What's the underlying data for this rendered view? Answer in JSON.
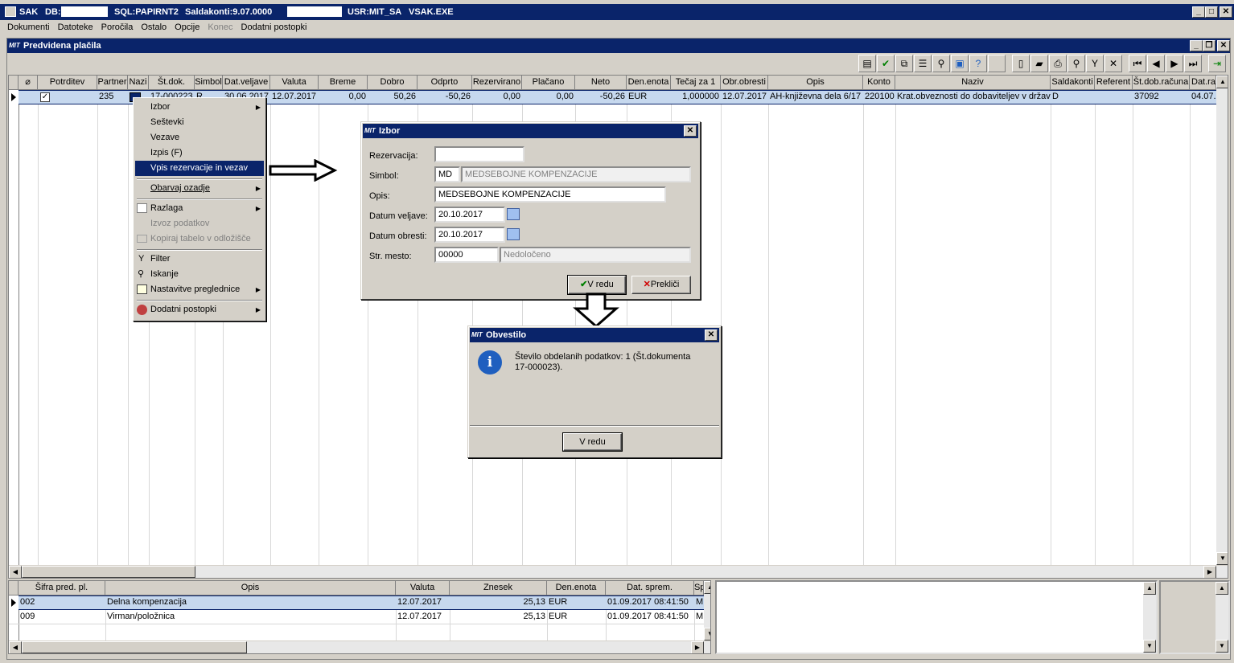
{
  "app_title": {
    "app": "SAK",
    "db": "DB:",
    "sql": "SQL:PAPIRNT2",
    "saldakonti": "Saldakonti:9.07.0000",
    "usr": "USR:MIT_SA",
    "exe": "VSAK.EXE"
  },
  "menu": [
    "Dokumenti",
    "Datoteke",
    "Poročila",
    "Ostalo",
    "Opcije",
    "Konec",
    "Dodatni postopki"
  ],
  "menu_disabled": [
    false,
    false,
    false,
    false,
    false,
    true,
    false
  ],
  "child_window": {
    "title": "Predvidena plačila",
    "logo": "MIT"
  },
  "main_grid": {
    "headers": [
      "Potrditev",
      "Partner",
      "Nazi",
      "Št.dok.",
      "Simbol",
      "Dat.veljave",
      "Valuta",
      "Breme",
      "Dobro",
      "Odprto",
      "Rezervirano",
      "Plačano",
      "Neto",
      "Den.enota",
      "Tečaj za 1",
      "Obr.obresti",
      "Opis",
      "Konto",
      "Naziv",
      "Saldakonti",
      "Referent",
      "Št.dob.računa",
      "Dat.rač"
    ],
    "row": {
      "partner": "235",
      "stdok": "17-000223",
      "simbol": "R",
      "datveljave": "30.06.2017",
      "valuta": "12.07.2017",
      "breme": "0,00",
      "dobro": "50,26",
      "odprto": "-50,26",
      "rezervirano": "0,00",
      "placano": "0,00",
      "neto": "-50,26",
      "denenota": "EUR",
      "tecaj": "1,000000",
      "obrobresti": "12.07.2017",
      "opis": "AH-književna dela 6/17",
      "konto": "220100",
      "naziv": "Krat.obveznosti do dobaviteljev v državi",
      "saldakonti": "D",
      "referent": "",
      "stdobracuna": "37092",
      "datrac": "04.07."
    }
  },
  "context_menu": {
    "items": [
      {
        "label": "Izbor",
        "sub": true
      },
      {
        "label": "Seštevki"
      },
      {
        "label": "Vezave"
      },
      {
        "label": "Izpis (F)"
      },
      {
        "label": "Vpis rezervacije in vezav",
        "selected": true
      },
      {
        "label": "Obarvaj ozadje",
        "sub": true
      },
      {
        "label": "Razlaga",
        "sub": true
      },
      {
        "label": "Izvoz podatkov",
        "disabled": true
      },
      {
        "label": "Kopiraj tabelo v odložišče",
        "disabled": true
      },
      {
        "label": "Filter"
      },
      {
        "label": "Iskanje"
      },
      {
        "label": "Nastavitve preglednice",
        "sub": true
      },
      {
        "label": "Dodatni postopki",
        "sub": true
      }
    ]
  },
  "izbor_dialog": {
    "title": "Izbor",
    "labels": {
      "rezervacija": "Rezervacija:",
      "simbol": "Simbol:",
      "opis": "Opis:",
      "datum_veljave": "Datum veljave:",
      "datum_obresti": "Datum obresti:",
      "str_mesto": "Str. mesto:"
    },
    "values": {
      "rezervacija": "",
      "simbol_code": "MD",
      "simbol_name": "MEDSEBOJNE KOMPENZACIJE",
      "opis": "MEDSEBOJNE KOMPENZACIJE",
      "datum_veljave": "20.10.2017",
      "datum_obresti": "20.10.2017",
      "str_mesto_code": "00000",
      "str_mesto_name": "Nedoločeno"
    },
    "ok_label": "V redu",
    "cancel_label": "Prekliči"
  },
  "obvestilo_dialog": {
    "title": "Obvestilo",
    "message_line1": "Število obdelanih podatkov: 1 (Št.dokumenta",
    "message_line2": "17-000023).",
    "ok_label": "V redu"
  },
  "bottom_grid": {
    "headers": [
      "Šifra pred. pl.",
      "Opis",
      "Valuta",
      "Znesek",
      "Den.enota",
      "Dat. sprem.",
      "Sp"
    ],
    "rows": [
      {
        "sifra": "002",
        "opis": "Delna kompenzacija",
        "valuta": "12.07.2017",
        "znesek": "25,13",
        "denenota": "EUR",
        "datsprem": "01.09.2017 08:41:50",
        "sp": "M"
      },
      {
        "sifra": "009",
        "opis": "Virman/položnica",
        "valuta": "12.07.2017",
        "znesek": "25,13",
        "denenota": "EUR",
        "datsprem": "01.09.2017 08:41:50",
        "sp": "M"
      }
    ]
  },
  "colors": {
    "titlebar": "#0a246a",
    "face": "#d4d0c8",
    "selection_row": "#c6d8ee",
    "info_icon": "#1f5fbf"
  }
}
